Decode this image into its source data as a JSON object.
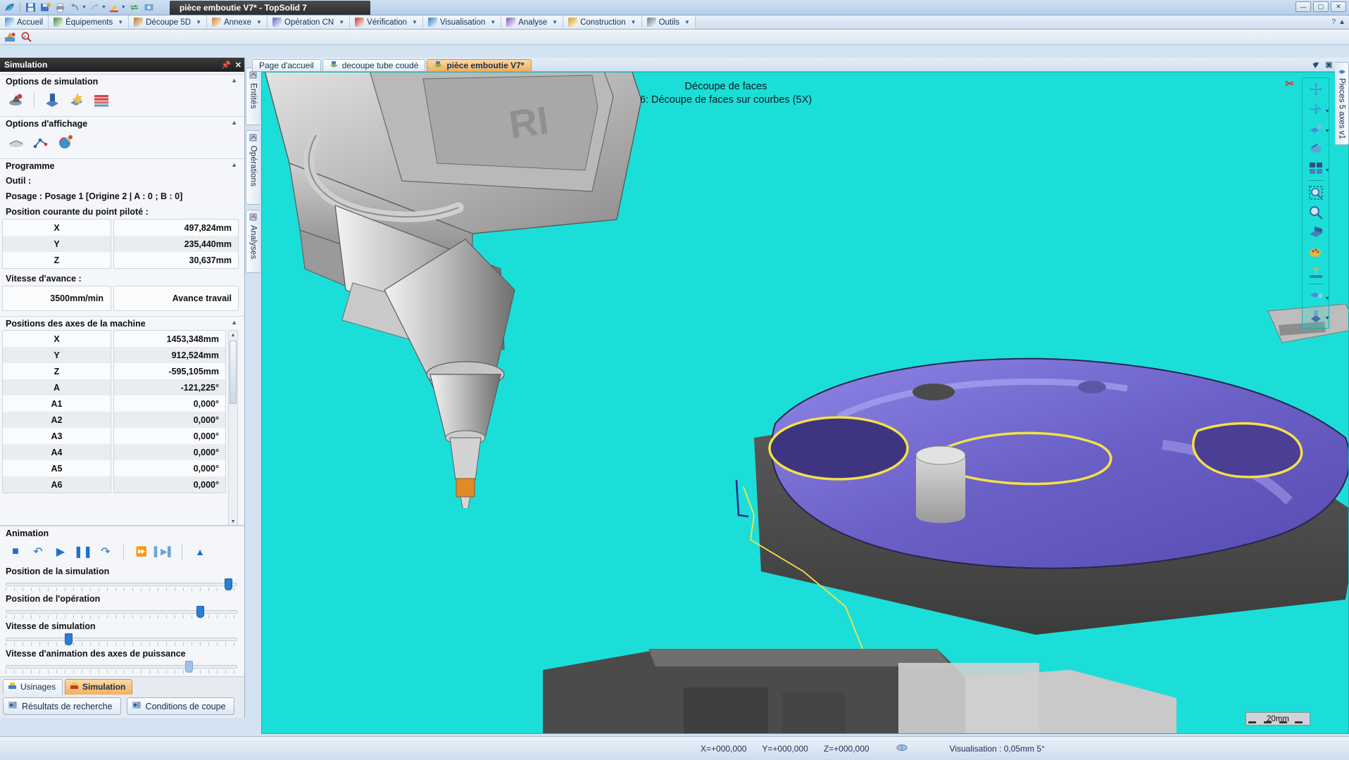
{
  "window": {
    "title": "pièce emboutie V7* - TopSolid 7",
    "controls": [
      "—",
      "▢",
      "✕"
    ]
  },
  "quick_access": {
    "icons": [
      "leaf-logo-icon",
      "save-icon",
      "save-as-icon",
      "print-icon",
      "undo-icon",
      "redo-icon",
      "highlighter-icon",
      "refresh-icon",
      "snapshot-icon"
    ]
  },
  "ribbon": {
    "tabs": [
      {
        "label": "Accueil",
        "icon": "home-icon",
        "dropdown": false
      },
      {
        "label": "Équipements",
        "icon": "equipment-icon",
        "dropdown": true
      },
      {
        "label": "Découpe 5D",
        "icon": "cut5d-icon",
        "dropdown": true
      },
      {
        "label": "Annexe",
        "icon": "annex-icon",
        "dropdown": true
      },
      {
        "label": "Opération CN",
        "icon": "nc-operation-icon",
        "dropdown": true
      },
      {
        "label": "Vérification",
        "icon": "verification-icon",
        "dropdown": true
      },
      {
        "label": "Visualisation",
        "icon": "visualisation-icon",
        "dropdown": true
      },
      {
        "label": "Analyse",
        "icon": "analysis-icon",
        "dropdown": true
      },
      {
        "label": "Construction",
        "icon": "construction-icon",
        "dropdown": true
      },
      {
        "label": "Outils",
        "icon": "tools-icon",
        "dropdown": true
      }
    ]
  },
  "toolbar2": {
    "icons": [
      "machining-setup-icon",
      "tool-search-icon"
    ]
  },
  "panel": {
    "title": "Simulation",
    "pin_icon": "pin-icon",
    "close_icon": "close-icon",
    "groups": {
      "simulation_options": {
        "title": "Options de simulation",
        "collapse_icon": "chevron-up-icon",
        "icons": [
          "simulation-mode-icon",
          "stock-icon",
          "collision-icon",
          "layers-icon"
        ]
      },
      "display_options": {
        "title": "Options d'affichage",
        "collapse_icon": "chevron-up-icon",
        "icons": [
          "display-stock-icon",
          "display-path-icon",
          "display-colors-icon"
        ]
      },
      "programme": {
        "title": "Programme",
        "collapse_icon": "chevron-up-icon",
        "tool_label": "Outil :",
        "posage_label": "Posage : Posage 1 [Origine 2 | A : 0 ; B : 0]",
        "current_point_label": "Position courante du point piloté :",
        "current_point": [
          {
            "axis": "X",
            "value": "497,824mm"
          },
          {
            "axis": "Y",
            "value": "235,440mm"
          },
          {
            "axis": "Z",
            "value": "30,637mm"
          }
        ],
        "feed_label": "Vitesse d'avance :",
        "feed_value": "3500mm/min",
        "feed_mode": "Avance travail"
      },
      "machine_axes": {
        "title": "Positions des axes de la machine",
        "collapse_icon": "chevron-up-icon",
        "rows": [
          {
            "axis": "X",
            "value": "1453,348mm"
          },
          {
            "axis": "Y",
            "value": "912,524mm"
          },
          {
            "axis": "Z",
            "value": "-595,105mm"
          },
          {
            "axis": "A",
            "value": "-121,225°"
          },
          {
            "axis": "A1",
            "value": "0,000°"
          },
          {
            "axis": "A2",
            "value": "0,000°"
          },
          {
            "axis": "A3",
            "value": "0,000°"
          },
          {
            "axis": "A4",
            "value": "0,000°"
          },
          {
            "axis": "A5",
            "value": "0,000°"
          },
          {
            "axis": "A6",
            "value": "0,000°"
          }
        ]
      },
      "animation": {
        "title": "Animation",
        "buttons": [
          {
            "name": "stop-button",
            "glyph": "■"
          },
          {
            "name": "step-back-button",
            "glyph": "↶"
          },
          {
            "name": "play-button",
            "glyph": "▶"
          },
          {
            "name": "pause-button",
            "glyph": "❚❚"
          },
          {
            "name": "step-forward-button",
            "glyph": "↷"
          },
          {
            "name": "fast-forward-button",
            "glyph": "⏩"
          },
          {
            "name": "frame-step-button",
            "glyph": "▌▶▌"
          },
          {
            "name": "eject-button",
            "glyph": "▲"
          }
        ],
        "sliders": [
          {
            "label": "Position de la simulation",
            "percent": 96
          },
          {
            "label": "Position de l'opération",
            "percent": 84
          },
          {
            "label": "Vitesse de simulation",
            "percent": 27
          },
          {
            "label": "Vitesse d'animation des axes de puissance",
            "percent": 79
          }
        ]
      }
    },
    "side_tabs": [
      {
        "label": "Entités",
        "icon": "entities-icon"
      },
      {
        "label": "Opérations",
        "icon": "operations-icon"
      },
      {
        "label": "Analyses",
        "icon": "analyses-icon"
      }
    ],
    "bottom_tabs": [
      {
        "label": "Usinages",
        "icon": "machining-icon",
        "active": false
      },
      {
        "label": "Simulation",
        "icon": "simulation-icon",
        "active": true
      }
    ],
    "bottom_tabs2": [
      {
        "label": "Résultats de recherche",
        "icon": "search-results-icon"
      },
      {
        "label": "Conditions de coupe",
        "icon": "cutting-conditions-icon"
      }
    ]
  },
  "document_tabs": [
    {
      "label": "Page d'accueil",
      "icon": "",
      "active": false
    },
    {
      "label": "decoupe tube coudé",
      "icon": "doc-icon",
      "active": false
    },
    {
      "label": "pièce emboutie V7*",
      "icon": "doc-icon",
      "active": true
    }
  ],
  "viewport": {
    "annotation_line1": "Découpe de faces",
    "annotation_line2": "6: Découpe de faces sur courbes (5X)",
    "background_color": "#1cded8",
    "part_color": "#6a62c8",
    "scale_label": "20mm",
    "close_icon": "close-view-icon",
    "right_tab_label": "Pieces 5 axes v1",
    "toolbar_icons": [
      "pan-icon",
      "rotate-icon",
      "view-direction-icon",
      "dynamic-view-icon",
      "split-view-icon",
      "zoom-window-icon",
      "zoom-icon",
      "section-icon",
      "render-icon",
      "help-icon",
      "light-icon",
      "extrude-icon"
    ]
  },
  "statusbar": {
    "x": "X=+000,000",
    "y": "Y=+000,000",
    "z": "Z=+000,000",
    "mouse_icon": "mouse-icon",
    "visualisation": "Visualisation : 0,05mm 5°"
  }
}
